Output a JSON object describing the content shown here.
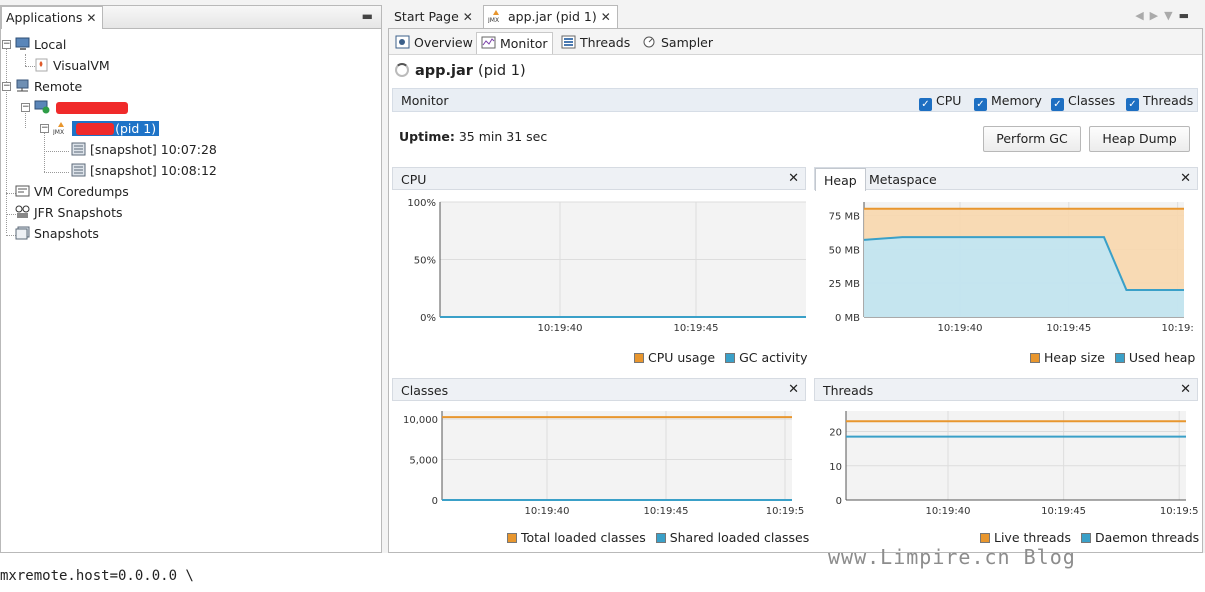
{
  "left_panel": {
    "tab_label": "Applications",
    "tree": {
      "local": "Local",
      "visualvm": "VisualVM",
      "remote": "Remote",
      "remote_app": "r (pid 1)",
      "snapshot1": "[snapshot] 10:07:28",
      "snapshot2": "[snapshot] 10:08:12",
      "coredumps": "VM Coredumps",
      "jfr": "JFR Snapshots",
      "snapshots": "Snapshots"
    }
  },
  "right_panel": {
    "tabs": {
      "start_page": "Start Page",
      "app_tab": "app.jar (pid 1)"
    },
    "subtabs": {
      "overview": "Overview",
      "monitor": "Monitor",
      "threads": "Threads",
      "sampler": "Sampler"
    },
    "title": {
      "name": "app.jar",
      "pid": "(pid 1)"
    },
    "monitor_bar": {
      "label": "Monitor",
      "checks": {
        "cpu": "CPU",
        "memory": "Memory",
        "classes": "Classes",
        "threads": "Threads"
      }
    },
    "uptime": {
      "label": "Uptime:",
      "value": "35 min 31 sec"
    },
    "buttons": {
      "perform_gc": "Perform GC",
      "heap_dump": "Heap Dump"
    }
  },
  "colors": {
    "orange": "#e8962e",
    "blue": "#3aa0c8",
    "heap_fill": "#f8d7ad",
    "used_fill": "#bfe6f5",
    "selection": "#1e73c7"
  },
  "chart_data": [
    {
      "type": "line",
      "title": "CPU",
      "x": [
        "10:19:40",
        "10:19:45",
        "10:19:5"
      ],
      "yticks": [
        "100%",
        "50%",
        "0%"
      ],
      "ylim": [
        0,
        100
      ],
      "series": [
        {
          "name": "CPU usage",
          "color": "#e8962e",
          "values": [
            0,
            0,
            0
          ]
        },
        {
          "name": "GC activity",
          "color": "#3aa0c8",
          "values": [
            0,
            0,
            0
          ]
        }
      ]
    },
    {
      "type": "area",
      "title": "Heap",
      "tabs": [
        "Heap",
        "Metaspace"
      ],
      "x": [
        "10:19:40",
        "10:19:45",
        "10:19:"
      ],
      "yticks": [
        "75 MB",
        "50 MB",
        "25 MB",
        "0 MB"
      ],
      "ylim": [
        0,
        85
      ],
      "series": [
        {
          "name": "Heap size",
          "color": "#e8962e",
          "points": [
            [
              0,
              80
            ],
            [
              1,
              80
            ]
          ]
        },
        {
          "name": "Used heap",
          "color": "#3aa0c8",
          "points": [
            [
              0,
              57
            ],
            [
              0.12,
              59
            ],
            [
              0.75,
              59
            ],
            [
              0.82,
              20
            ],
            [
              1,
              20
            ]
          ]
        }
      ]
    },
    {
      "type": "line",
      "title": "Classes",
      "x": [
        "10:19:40",
        "10:19:45",
        "10:19:5"
      ],
      "yticks": [
        "10,000",
        "5,000",
        "0"
      ],
      "ylim": [
        0,
        11000
      ],
      "series": [
        {
          "name": "Total loaded classes",
          "color": "#e8962e",
          "values": [
            10250,
            10250,
            10250
          ]
        },
        {
          "name": "Shared loaded classes",
          "color": "#3aa0c8",
          "values": [
            0,
            0,
            0
          ]
        }
      ]
    },
    {
      "type": "line",
      "title": "Threads",
      "x": [
        "10:19:40",
        "10:19:45",
        "10:19:5"
      ],
      "yticks": [
        "20",
        "10",
        "0"
      ],
      "ylim": [
        0,
        26
      ],
      "series": [
        {
          "name": "Live threads",
          "color": "#e8962e",
          "values": [
            23,
            23,
            23
          ]
        },
        {
          "name": "Daemon threads",
          "color": "#3aa0c8",
          "values": [
            18.5,
            18.5,
            18.5
          ]
        }
      ]
    }
  ],
  "bottom": {
    "console_text": "mxremote.host=0.0.0.0 \\"
  },
  "watermark": "www.Limpire.cn Blog"
}
